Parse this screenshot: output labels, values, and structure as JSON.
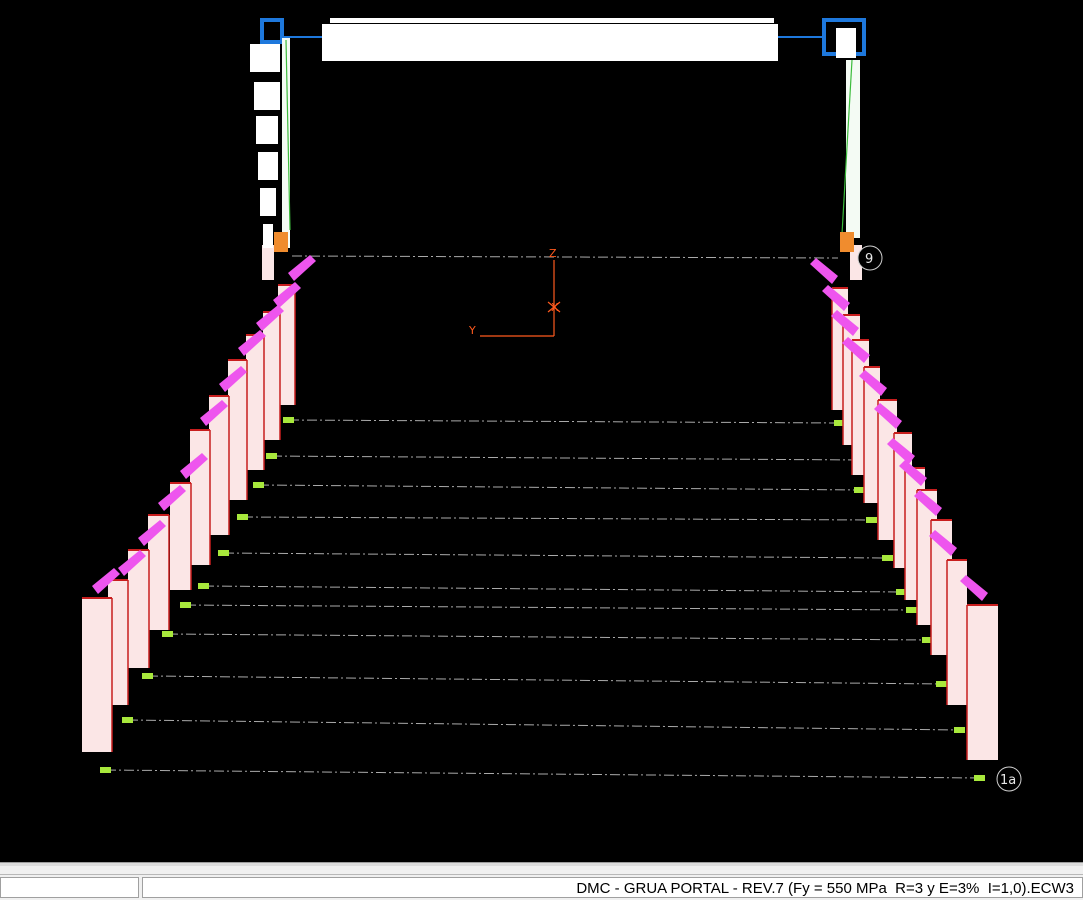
{
  "viewport": {
    "axes": {
      "z_label": "Z",
      "x_label": "X",
      "y_label": "Y"
    },
    "grid_bubbles": [
      "9",
      "1a"
    ],
    "colors": {
      "background": "#000000",
      "column": "#fbe6e6",
      "column_edge": "#c81e1e",
      "beam": "#ee55ee",
      "frame_white": "#ffffff",
      "frame_blue": "#1e78dc",
      "support": "#a8e83c",
      "axis": "#ff5a1e",
      "gridline": "#c8c8c8"
    }
  },
  "statusbar": {
    "left_pane": "",
    "model_file": "DMC - GRUA PORTAL - REV.7 (Fy = 550 MPa  R=3 y E=3%  I=1,0).ECW3"
  }
}
